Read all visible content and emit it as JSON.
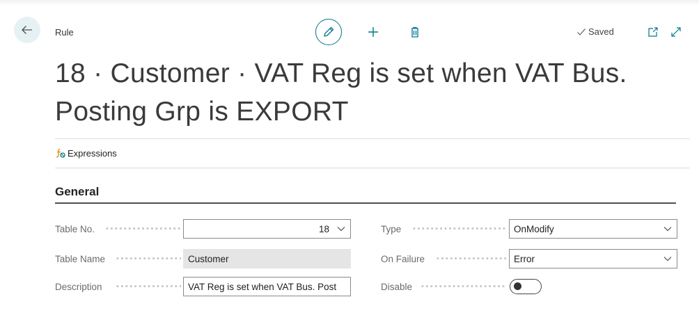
{
  "header": {
    "caption": "Rule",
    "saved_label": "Saved",
    "title": "18 · Customer · VAT Reg is set when VAT Bus. Posting Grp is EXPORT"
  },
  "actions": {
    "expressions_label": "Expressions"
  },
  "general": {
    "title": "General",
    "table_no": {
      "label": "Table No.",
      "value": "18"
    },
    "table_name": {
      "label": "Table Name",
      "value": "Customer"
    },
    "description": {
      "label": "Description",
      "value": "VAT Reg is set when VAT Bus. Post"
    },
    "type": {
      "label": "Type",
      "value": "OnModify"
    },
    "on_failure": {
      "label": "On Failure",
      "value": "Error"
    },
    "disable": {
      "label": "Disable",
      "value": "Off"
    }
  },
  "icons": {
    "back": "arrow-left-icon",
    "edit": "pencil-icon",
    "new": "plus-icon",
    "delete": "trash-icon",
    "saved": "checkmark-icon",
    "open_new_window": "open-in-new-window-icon",
    "expand": "expand-icon",
    "expressions": "function-icon",
    "dropdown": "chevron-down-icon"
  },
  "colors": {
    "accent": "#00788a",
    "back_button_bg": "#e6f1f4",
    "readonly_field_bg": "#e5e5e5"
  }
}
